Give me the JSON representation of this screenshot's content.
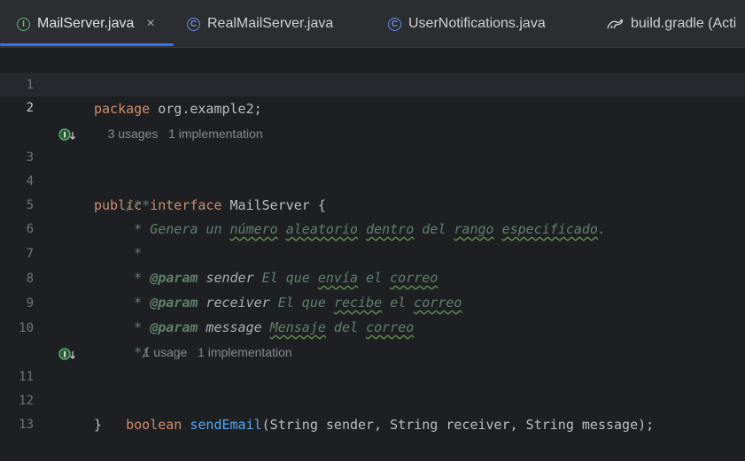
{
  "tabs": [
    {
      "label": "MailServer.java",
      "icon": "interface-icon",
      "active": true
    },
    {
      "label": "RealMailServer.java",
      "icon": "class-icon",
      "active": false
    },
    {
      "label": "UserNotifications.java",
      "icon": "class-icon",
      "active": false
    },
    {
      "label": "build.gradle (Acti",
      "icon": "gradle-icon",
      "active": false
    }
  ],
  "tab_close_glyph": "×",
  "line_numbers": [
    "1",
    "2",
    "3",
    "4",
    "5",
    "6",
    "7",
    "8",
    "9",
    "10",
    "11",
    "12",
    "13"
  ],
  "code": {
    "l1_kw": "package",
    "l1_rest": " org.example2;",
    "inlay1_usages": "3 usages",
    "inlay1_impl": "1 implementation",
    "l3_kw1": "public",
    "l3_kw2": "interface",
    "l3_rest": " MailServer {",
    "l4": "/**",
    "l5_a": " * Genera un ",
    "l5_w1": "número",
    "l5_sp1": " ",
    "l5_w2": "aleatorio",
    "l5_sp2": " ",
    "l5_w3": "dentro",
    "l5_sp3": " del ",
    "l5_w4": "rango",
    "l5_sp4": " ",
    "l5_w5": "especificado",
    "l5_end": ".",
    "l6": " *",
    "l7_a": " * ",
    "l7_tag": "@param",
    "l7_p": " sender",
    "l7_b": " El que ",
    "l7_w1": "envía",
    "l7_c": " el ",
    "l7_w2": "correo",
    "l8_a": " * ",
    "l8_tag": "@param",
    "l8_p": " receiver",
    "l8_b": " El que ",
    "l8_w1": "recibe",
    "l8_c": " el ",
    "l8_w2": "correo",
    "l9_a": " * ",
    "l9_tag": "@param",
    "l9_p": " message",
    "l9_b": " ",
    "l9_w1": "Mensaje",
    "l9_c": " del ",
    "l9_w2": "correo",
    "l10": " */",
    "inlay2_usages": "1 usage",
    "inlay2_impl": "1 implementation",
    "l11_kw": "boolean",
    "l11_sp": " ",
    "l11_fn": "sendEmail",
    "l11_rest": "(String sender, String receiver, String message);",
    "l12": "}"
  },
  "colors": {
    "keyword": "#cf8e6d",
    "function": "#56a8f5",
    "doc_comment": "#5f826b",
    "accent": "#3574f0"
  }
}
